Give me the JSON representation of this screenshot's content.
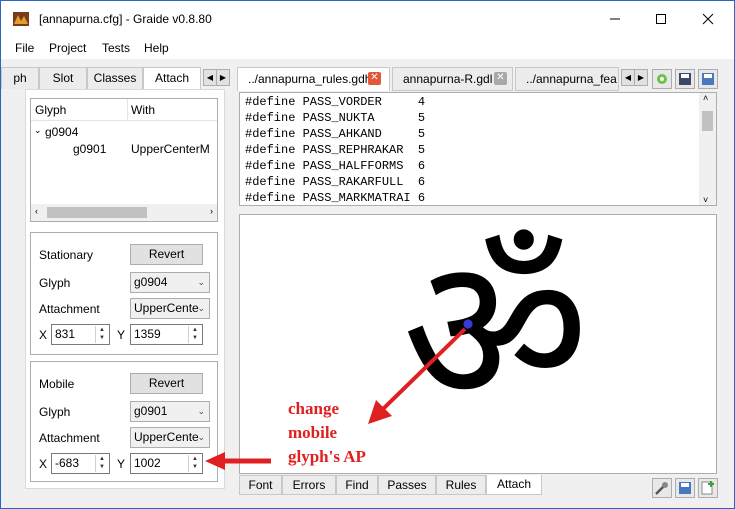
{
  "window": {
    "title": "[annapurna.cfg] - Graide v0.8.80",
    "controls": [
      "minimize-icon",
      "maximize-icon",
      "close-icon"
    ]
  },
  "menu": [
    "File",
    "Project",
    "Tests",
    "Help"
  ],
  "left_tabs": [
    "ph",
    "Slot",
    "Classes",
    "Attach"
  ],
  "left_active_tab": "Attach",
  "tree": {
    "headers": [
      "Glyph",
      "With"
    ],
    "rows": [
      {
        "glyph": "g0904",
        "with": ""
      },
      {
        "glyph": "g0901",
        "with": "UpperCenterM"
      }
    ]
  },
  "stationary": {
    "title": "Stationary",
    "revert": "Revert",
    "glyph_label": "Glyph",
    "glyph_value": "g0904",
    "attachment_label": "Attachment",
    "attachment_value": "UpperCente",
    "x_label": "X",
    "x_value": "831",
    "y_label": "Y",
    "y_value": "1359"
  },
  "mobile": {
    "title": "Mobile",
    "revert": "Revert",
    "glyph_label": "Glyph",
    "glyph_value": "g0901",
    "attachment_label": "Attachment",
    "attachment_value": "UpperCente",
    "x_label": "X",
    "x_value": "-683",
    "y_label": "Y",
    "y_value": "1002"
  },
  "file_tabs": [
    "../annapurna_rules.gdh",
    "annapurna-R.gdl",
    "../annapurna_fea"
  ],
  "code_lines": [
    "#define PASS_VORDER     4",
    "#define PASS_NUKTA      5",
    "#define PASS_AHKAND     5",
    "#define PASS_REPHRAKAR  5",
    "#define PASS_HALFFORMS  6",
    "#define PASS_RAKARFULL  6",
    "#define PASS_MARKMATRAI 6"
  ],
  "glyph_text": "ॐ",
  "annotation": [
    "change",
    "mobile",
    "glyph's AP"
  ],
  "bottom_tabs": [
    "Font",
    "Errors",
    "Find",
    "Passes",
    "Rules",
    "Attach"
  ],
  "bottom_active_tab": "Attach",
  "colors": {
    "annotation": "#e02020",
    "attach_point": "#3a3ad8",
    "close_tab": "#e05a3a"
  }
}
